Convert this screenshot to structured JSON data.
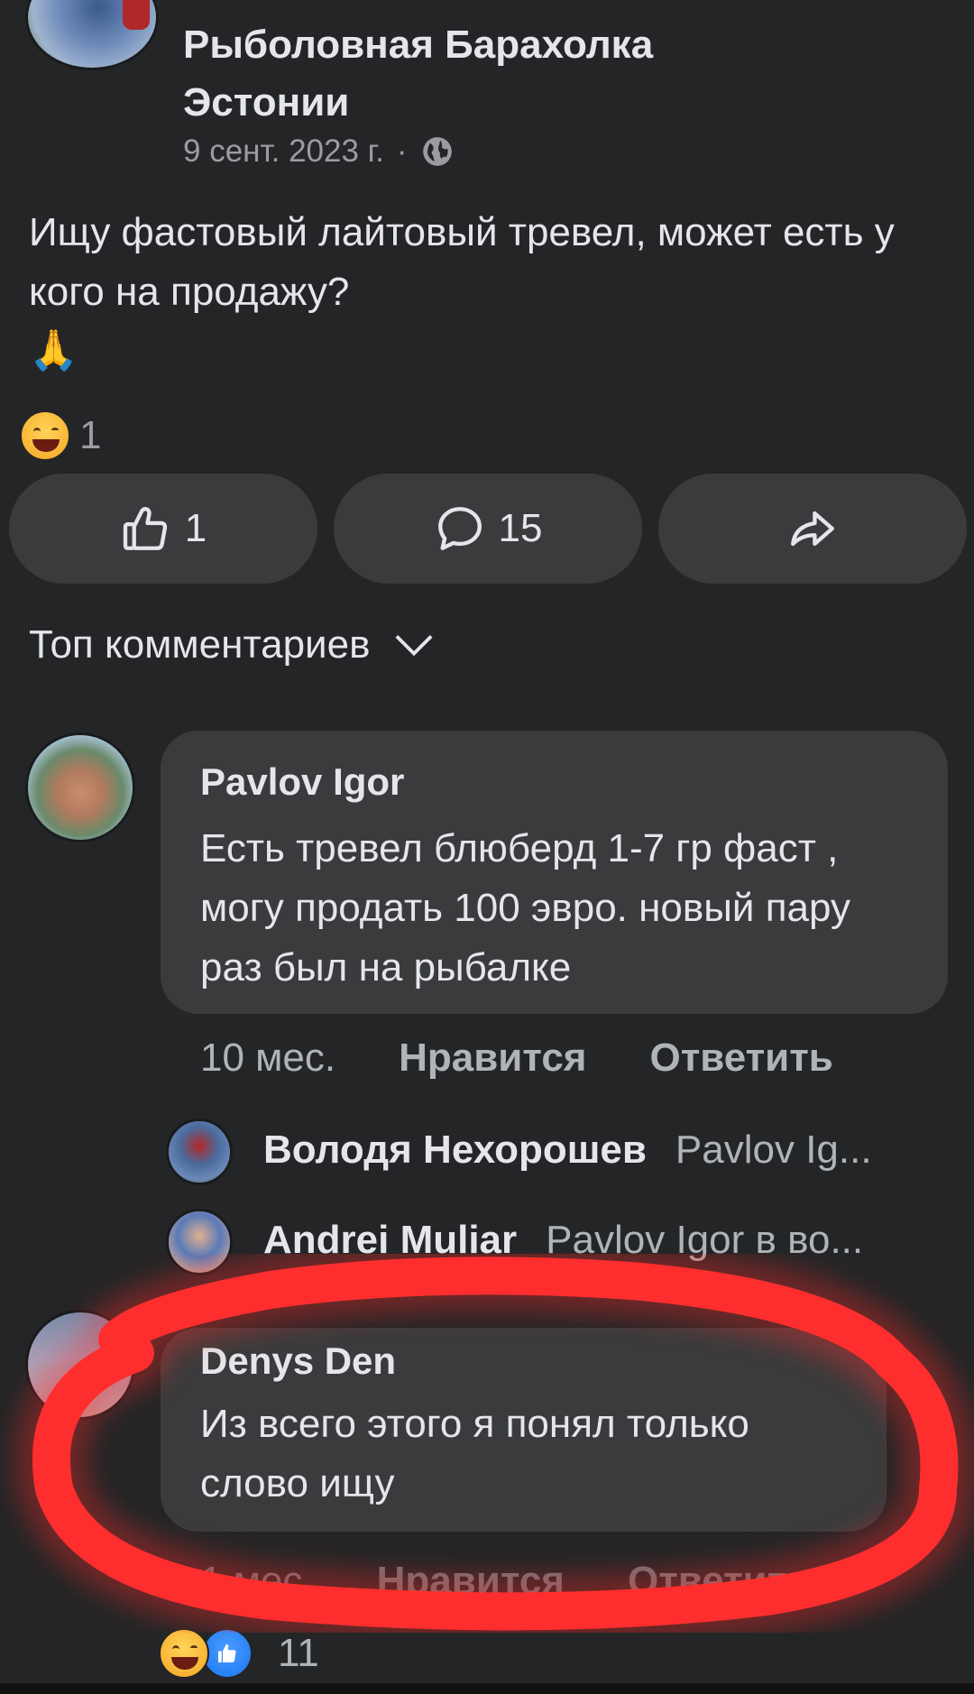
{
  "group": {
    "name": "Рыболовная Барахолка Эстонии",
    "date": "9 сент. 2023 г.",
    "separator": "·",
    "privacy_icon": "globe-icon"
  },
  "post": {
    "text": "Ищу фастовый лайтовый тревел, может есть у кого на продажу?",
    "emoji": "🙏",
    "reaction_count": "1"
  },
  "actions": {
    "like_count": "1",
    "comment_count": "15",
    "like_icon": "thumbs-up-icon",
    "comment_icon": "comment-bubble-icon",
    "share_icon": "share-arrow-icon"
  },
  "comments_sort": {
    "label": "Топ комментариев"
  },
  "comments": [
    {
      "author": "Pavlov Igor",
      "text": "Есть тревел блюберд 1-7 гр фаст , могу продать 100 эвро. новый пару раз был на рыбалке",
      "time": "10 мес.",
      "like_label": "Нравится",
      "reply_label": "Ответить",
      "replies": [
        {
          "author": "Володя Нехорошев",
          "snippet": "Pavlov Ig..."
        },
        {
          "author": "Andrei Muliar",
          "snippet": "Pavlov Igor в во..."
        }
      ]
    },
    {
      "author": "Denys Den",
      "text": "Из всего этого я понял только слово ищу",
      "time": "1 мес.",
      "like_label": "Нравится",
      "reply_label": "Ответить",
      "reaction_count": "11"
    }
  ],
  "colors": {
    "background": "#242526",
    "bubble": "#3a3b3c",
    "text": "#e4e6eb",
    "muted": "#b0b3b8",
    "highlight": "#ff2a2a"
  }
}
